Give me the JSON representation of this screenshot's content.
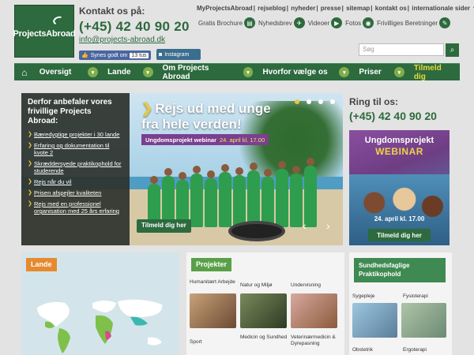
{
  "header": {
    "logo_text": "ProjectsAbroad",
    "contact_label": "Kontakt os på:",
    "phone": "(+45) 42 40 90 20",
    "email": "info@projects-abroad.dk",
    "like_label": "Synes godt om",
    "like_count": "13 tus",
    "instagram_label": "Instagram",
    "top_links": [
      "MyProjectsAbroad",
      "rejseblog",
      "nyheder",
      "presse",
      "sitemap",
      "kontakt os",
      "internationale sider"
    ],
    "quick_links": [
      {
        "label": "Gratis Brochure",
        "icon": "brochure-icon"
      },
      {
        "label": "Nyhedsbrev",
        "icon": "newsletter-icon"
      },
      {
        "label": "Videoer",
        "icon": "video-icon"
      },
      {
        "label": "Fotos",
        "icon": "camera-icon"
      },
      {
        "label": "Frivilliges Beretninger",
        "icon": "pen-icon"
      }
    ],
    "search_placeholder": "Søg"
  },
  "nav": {
    "items": [
      "Oversigt",
      "Lande",
      "Om Projects Abroad",
      "Hvorfor vælge os",
      "Priser"
    ],
    "cta": "Tilmeld dig"
  },
  "hero": {
    "reasons_title": "Derfor anbefaler vores frivillige Projects Abroad:",
    "reasons": [
      "Bæredygtige projekter i 30 lande",
      "Erfaring og dokumentation til kvote 2",
      "Skræddersyede praktikophold for studerende",
      "Rejs når du vil",
      "Prisen afspejler kvaliteten",
      "Rejs med en professionel organisation med 25 års erfaring"
    ],
    "headline": "Rejs ud med unge fra hele verden!",
    "webinar_tag": "Ungdomsprojekt webinar",
    "webinar_date": "24. april kl. 17.00",
    "cta": "Tilmeld dig her"
  },
  "sidebar": {
    "ring_label": "Ring til os:",
    "phone": "(+45) 42 40 90 20",
    "promo_title": "Ungdomsprojekt",
    "promo_subtitle": "WEBINAR",
    "promo_date": "24. april kl. 17.00",
    "promo_cta": "Tilmeld dig her"
  },
  "panels": {
    "lande_title": "Lande",
    "projekter_title": "Projekter",
    "projekter": [
      "Humanitært Arbejde",
      "Natur og Miljø",
      "Undervisning",
      "Sport",
      "Medicin og Sundhed",
      "Veterinærmedicin & Dyrepasning"
    ],
    "sund_title": "Sundhedsfaglige Praktikophold",
    "sund": [
      "Sygepleje",
      "Fysioterapi",
      "Obstetrik",
      "Ergoterapi"
    ]
  }
}
